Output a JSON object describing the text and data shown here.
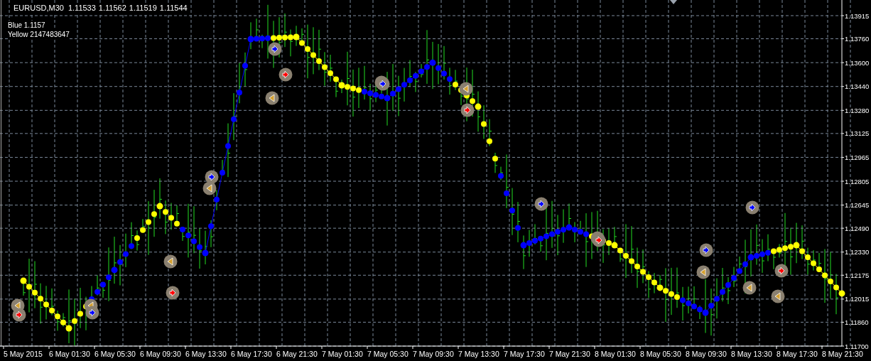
{
  "header": {
    "symbol": "EURUSD,M30",
    "quotes": [
      "1.11533",
      "1.11562",
      "1.11519",
      "1.11544"
    ]
  },
  "legend": [
    {
      "value": "1.1157"
    },
    {
      "value": "2147483647"
    }
  ],
  "chart_data": {
    "type": "line",
    "grid": true,
    "categories": [
      "5 May 2015",
      "6 May 01:30",
      "6 May 05:30",
      "6 May 09:30",
      "6 May 13:30",
      "6 May 17:30",
      "6 May 21:30",
      "7 May 01:30",
      "7 May 05:30",
      "7 May 09:30",
      "7 May 13:30",
      "7 May 17:30",
      "7 May 21:30",
      "8 May 01:30",
      "8 May 05:30",
      "8 May 09:30",
      "8 May 13:30",
      "8 May 17:30",
      "8 May 21:30"
    ],
    "series": [
      {
        "name": "Blue",
        "color": "#0000ff",
        "marker": "o",
        "values": [
          null,
          null,
          1.1221,
          null,
          1.12324,
          1.13758,
          null,
          null,
          1.13362,
          1.136,
          null,
          1.12376,
          1.12495,
          null,
          null,
          1.11924,
          1.12295,
          null,
          null
        ]
      },
      {
        "name": "Yellow",
        "color": "#ffff00",
        "marker": "o",
        "values": [
          1.12138,
          1.11819,
          null,
          1.12638,
          null,
          null,
          1.13772,
          1.13448,
          null,
          null,
          1.13305,
          null,
          null,
          1.12376,
          1.12091,
          null,
          null,
          1.12376,
          1.12053
        ]
      }
    ],
    "ylim": [
      1.117,
      1.13915
    ],
    "yticks": [
      {
        "value": 1.117,
        "label": "1.11700"
      },
      {
        "value": 1.1186,
        "label": "1.11860"
      },
      {
        "value": 1.12015,
        "label": "1.12015"
      },
      {
        "value": 1.12175,
        "label": "1.12175"
      },
      {
        "value": 1.1233,
        "label": "1.12330"
      },
      {
        "value": 1.1249,
        "label": "1.12490"
      },
      {
        "value": 1.12645,
        "label": "1.12645"
      },
      {
        "value": 1.12805,
        "label": "1.12805"
      },
      {
        "value": 1.12965,
        "label": "1.12965"
      },
      {
        "value": 1.13125,
        "label": "1.13125"
      },
      {
        "value": 1.1328,
        "label": "1.13280"
      },
      {
        "value": 1.1344,
        "label": "1.13440"
      },
      {
        "value": 1.136,
        "label": "1.13600"
      },
      {
        "value": 1.1376,
        "label": "1.13760"
      },
      {
        "value": 1.13915,
        "label": "1.13915"
      }
    ]
  }
}
